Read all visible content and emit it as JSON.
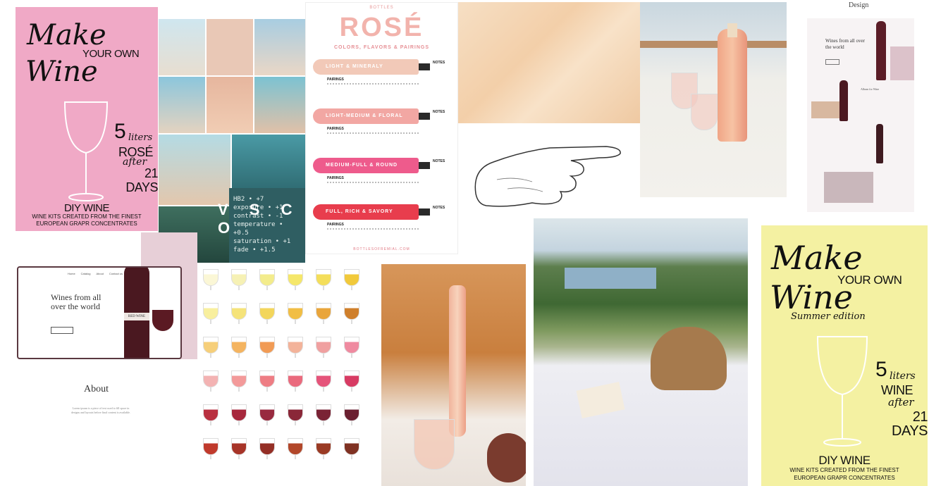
{
  "poster_pink": {
    "make": "Make",
    "your_own": "YOUR OWN",
    "wine": "Wine",
    "liters_num": "5",
    "liters": "liters",
    "variety": "ROSÉ",
    "after": "after",
    "days": "21 DAYS",
    "diy": "DIY WINE",
    "sub1": "WINE KITS CREATED FROM THE FINEST",
    "sub2": "EUROPEAN GRAPR CONCENTRATES",
    "color": "#f0a9c6"
  },
  "vsco": {
    "title": "V S C O",
    "code": [
      "HB2 • +7",
      "exposure • +1",
      "contrast • -1",
      "temperature • +0.5",
      "saturation • +1",
      "fade • +1.5"
    ]
  },
  "rose_chart": {
    "brand": "BOTTLES",
    "title": "ROSÉ",
    "subtitle": "COLORS, FLAVORS & PAIRINGS",
    "rows": [
      {
        "label": "LIGHT & MINERALY",
        "color": "#f2c9b8",
        "notes": "NOTES",
        "pairing": "PAIRINGS"
      },
      {
        "label": "LIGHT-MEDIUM & FLORAL",
        "color": "#f2a7a3",
        "notes": "NOTES",
        "pairing": "PAIRINGS"
      },
      {
        "label": "MEDIUM-FULL & ROUND",
        "color": "#ee5b8c",
        "notes": "NOTES",
        "pairing": "PAIRINGS"
      },
      {
        "label": "FULL, RICH & SAVORY",
        "color": "#e83d4d",
        "notes": "NOTES",
        "pairing": "PAIRINGS"
      }
    ],
    "footer": "BOTTLESOFREMIAL.COM"
  },
  "design_mock": {
    "label": "Design",
    "hero": "Wines from all over the world",
    "section": "Album for Wine"
  },
  "website": {
    "hero": "Wines from all over the world",
    "nav": [
      "Home",
      "Catalog",
      "About",
      "Contact us"
    ],
    "bottle_label": "RED WINE"
  },
  "about": {
    "title": "About",
    "text": "Lorem ipsum is a piece of text used to fill space in designs and layouts before final content is available."
  },
  "poster_yellow": {
    "make": "Make",
    "your_own": "YOUR OWN",
    "wine": "Wine",
    "edition": "Summer edition",
    "liters_num": "5",
    "liters": "liters",
    "variety": "WINE",
    "after": "after",
    "days": "21 DAYS",
    "diy": "DIY WINE",
    "sub1": "WINE KITS CREATED FROM THE FINEST",
    "sub2": "EUROPEAN GRAPR CONCENTRATES",
    "color": "#f4f1a2"
  },
  "glass_grid": {
    "colors": [
      [
        "#fbf7d6",
        "#f6f1b5",
        "#f3ec8c",
        "#f5e76a",
        "#f4de5a",
        "#f1c93b"
      ],
      [
        "#f8ef9e",
        "#f5e37a",
        "#f3d65c",
        "#f1be45",
        "#e9a53b",
        "#cf7f2b"
      ],
      [
        "#f6cf7a",
        "#f4b460",
        "#f19b55",
        "#f3b39a",
        "#f0a0a0",
        "#ef8aa0"
      ],
      [
        "#f3b3b3",
        "#f39a9a",
        "#ee7d84",
        "#ea6a7d",
        "#e5547a",
        "#d73b63"
      ],
      [
        "#b93040",
        "#a7283d",
        "#982a3f",
        "#8a2738",
        "#7a2335",
        "#6a1f30"
      ],
      [
        "#c03a2c",
        "#a73428",
        "#942f26",
        "#b2472a",
        "#9a3a24",
        "#7f3122"
      ]
    ]
  }
}
